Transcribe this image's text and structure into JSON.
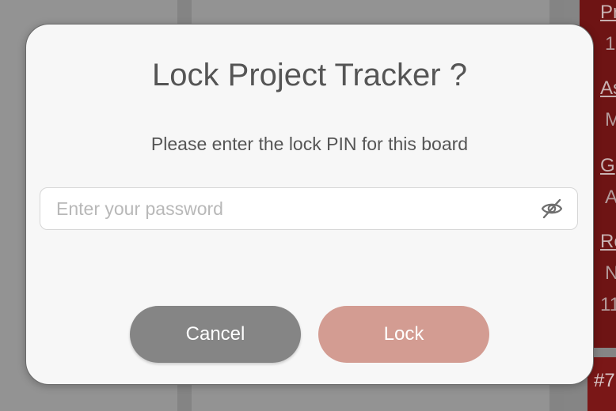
{
  "dialog": {
    "title": "Lock Project Tracker ?",
    "message": "Please enter the lock PIN for this board",
    "password_placeholder": "Enter your password",
    "password_value": "",
    "visibility_icon": "eye-off-icon",
    "cancel_label": "Cancel",
    "lock_label": "Lock"
  },
  "background": {
    "card_fragments": [
      "Pr",
      "1",
      "As",
      "M",
      "G",
      "A",
      "Re",
      "N",
      "11",
      "#7"
    ]
  },
  "colors": {
    "cancel_button": "#858585",
    "lock_button": "#d39c92",
    "card_red": "#6e1414",
    "overlay": "#8e8e8e"
  }
}
